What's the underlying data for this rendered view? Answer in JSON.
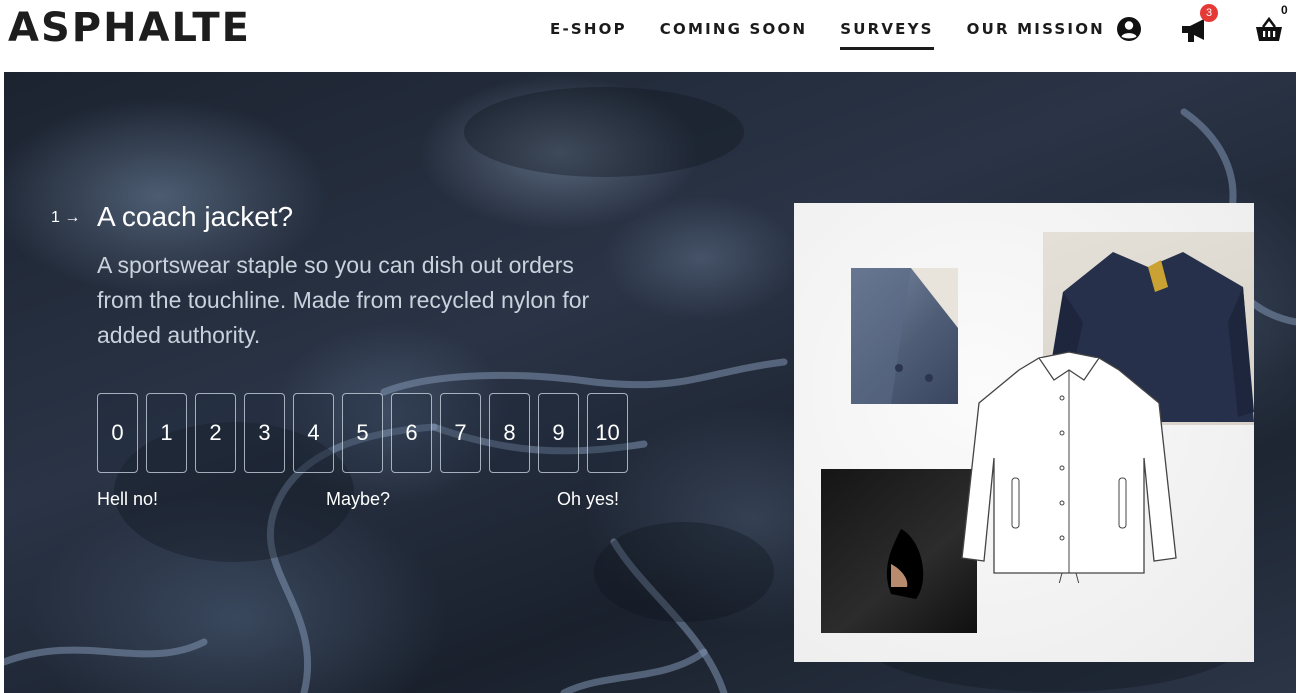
{
  "header": {
    "logo": "ASPHALTE",
    "nav": [
      {
        "label": "E-SHOP",
        "active": false
      },
      {
        "label": "COMING SOON",
        "active": false
      },
      {
        "label": "SURVEYS",
        "active": true
      },
      {
        "label": "OUR MISSION",
        "active": false
      }
    ],
    "icons": {
      "account": "account-icon",
      "megaphone": "megaphone-icon",
      "cart": "basket-icon"
    },
    "notification_count": "3",
    "cart_count": "0"
  },
  "survey": {
    "question_number": "1",
    "question_arrow": "→",
    "title": "A coach jacket?",
    "description": "A sportswear staple so you can dish out orders from the touchline. Made from recycled nylon for added authority.",
    "scale": [
      "0",
      "1",
      "2",
      "3",
      "4",
      "5",
      "6",
      "7",
      "8",
      "9",
      "10"
    ],
    "label_low": "Hell no!",
    "label_mid": "Maybe?",
    "label_high": "Oh yes!"
  },
  "colors": {
    "accent": "#1b1b1b",
    "badge": "#e53935",
    "hero_dark": "#1c2330",
    "text_on_hero": "#ffffff"
  }
}
